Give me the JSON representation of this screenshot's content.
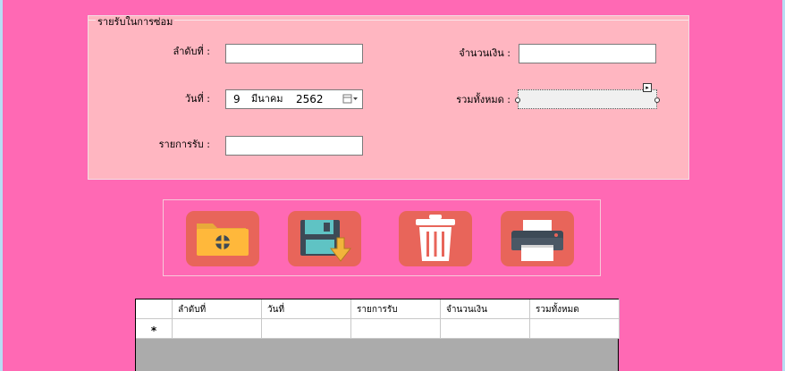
{
  "groupbox": {
    "title": "รายรับในการซ่อม"
  },
  "form": {
    "order_label": "ลำดับที่ :",
    "order_value": "",
    "date_label": "วันที่ :",
    "date": {
      "day": "9",
      "month": "มีนาคม",
      "year": "2562"
    },
    "item_label": "รายการรับ :",
    "item_value": "",
    "amount_label": "จำนวนเงิน :",
    "amount_value": "",
    "total_label": "รวมทั้งหมด :",
    "total_value": ""
  },
  "toolbar": {
    "buttons": [
      {
        "icon": "open-folder-icon"
      },
      {
        "icon": "save-download-icon"
      },
      {
        "icon": "trash-bin-icon"
      },
      {
        "icon": "printer-icon"
      }
    ],
    "button_color": "#e8655a"
  },
  "grid": {
    "columns": [
      "ลำดับที่",
      "วันที่",
      "รายการรับ",
      "จำนวนเงิน",
      "รวมทั้งหมด"
    ],
    "new_row_marker": "*",
    "rows": []
  },
  "colors": {
    "background": "#ff69b4",
    "groupbox": "#ffb6c1",
    "grid_empty": "#ababab"
  }
}
